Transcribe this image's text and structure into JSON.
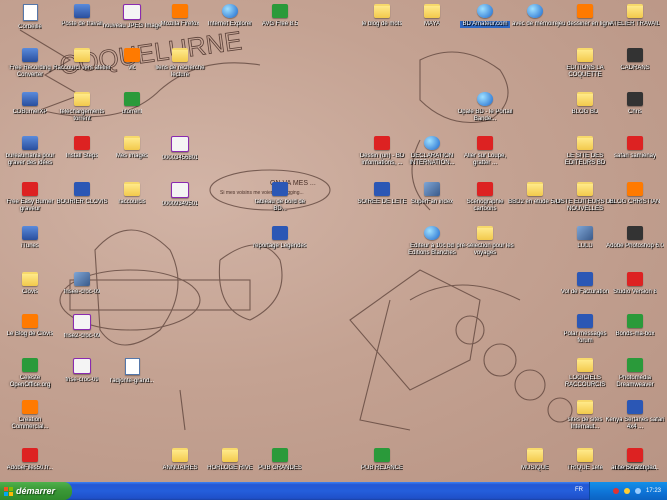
{
  "desktop": {
    "icons": [
      {
        "label": "Corbeille",
        "type": "doc"
      },
      {
        "label": "Poste de travail",
        "type": "app"
      },
      {
        "label": "nouveau JPEG Image",
        "type": "jpeg"
      },
      {
        "label": "Mozilla Firefox",
        "type": "orange"
      },
      {
        "label": "Internet Explorer",
        "type": "web"
      },
      {
        "label": "AVG Free 8.5",
        "type": "green"
      },
      {
        "label": "le blog de mots",
        "type": "folder"
      },
      {
        "label": "MAYA",
        "type": "folder"
      },
      {
        "label": "BD Amateur.com",
        "type": "web",
        "selected": true
      },
      {
        "label": "avec de mémoire",
        "type": "web"
      },
      {
        "label": "jeu dessiner en ligne",
        "type": "orange"
      },
      {
        "label": "ATELIER TRAVAIL",
        "type": "folder"
      },
      {
        "label": "Free Recording Converter",
        "type": "app"
      },
      {
        "label": "Raccourci vers atelier",
        "type": "folder"
      },
      {
        "label": "vlc",
        "type": "orange"
      },
      {
        "label": "liens de recherche lecture",
        "type": "folder"
      },
      {
        "label": "EDITIONS LA COQUETTE",
        "type": "folder"
      },
      {
        "label": "CADRANS",
        "type": "dark"
      },
      {
        "label": "CDBurnerXP",
        "type": "app"
      },
      {
        "label": "téléchargements torrent",
        "type": "folder"
      },
      {
        "label": "utorrent",
        "type": "green"
      },
      {
        "label": "Opale BD - le Portail Bande...",
        "type": "web"
      },
      {
        "label": "BLOG BD",
        "type": "folder"
      },
      {
        "label": "Chris",
        "type": "dark"
      },
      {
        "label": "bureaumania pour graver des idées",
        "type": "app"
      },
      {
        "label": "Install Steps",
        "type": "red"
      },
      {
        "label": "Mes images",
        "type": "folder"
      },
      {
        "label": "00003456801",
        "type": "jpeg"
      },
      {
        "label": "Dessin (un) - BD informations, ...",
        "type": "red"
      },
      {
        "label": "DECLARATION INTERNATION...",
        "type": "web"
      },
      {
        "label": "Aller sur Loupe, gratter ...",
        "type": "red"
      },
      {
        "label": "LE SITE DES EDITEURS BD",
        "type": "folder"
      },
      {
        "label": "safari samienay",
        "type": "red"
      },
      {
        "label": "Free Easy Burner graveur",
        "type": "red"
      },
      {
        "label": "BOURIER CLOVIS",
        "type": "word"
      },
      {
        "label": "raccourcis",
        "type": "folder"
      },
      {
        "label": "00009349501",
        "type": "jpeg"
      },
      {
        "label": "tableau de bord de BD...",
        "type": "word"
      },
      {
        "label": "SOIREE DE LETE",
        "type": "word"
      },
      {
        "label": "SuperFan index",
        "type": "photo"
      },
      {
        "label": "Scénographie cartoons",
        "type": "red"
      },
      {
        "label": "BBD2 en etude 5AX",
        "type": "folder"
      },
      {
        "label": "LISTE EDITEURS DE NOUVELLES",
        "type": "folder"
      },
      {
        "label": "BLOG CHRISTIAN",
        "type": "orange"
      },
      {
        "label": "iTunes",
        "type": "app"
      },
      {
        "label": "reportage Legendes",
        "type": "word"
      },
      {
        "label": "Editeur à 10c bd Editions Blanches",
        "type": "web"
      },
      {
        "label": "pré-sélection pour les voyages",
        "type": "folder"
      },
      {
        "label": "LULU",
        "type": "photo"
      },
      {
        "label": "Adobe Photoshop 6.0",
        "type": "dark"
      },
      {
        "label": "Clovis",
        "type": "folder"
      },
      {
        "label": "frisee-croc-09",
        "type": "photo"
      },
      {
        "label": "Vol de Facturation",
        "type": "word"
      },
      {
        "label": "Studio Version 8",
        "type": "red"
      },
      {
        "label": "Le Blog de Clovis",
        "type": "orange"
      },
      {
        "label": "frise2-croc-09",
        "type": "jpeg"
      },
      {
        "label": "Polar messages forum",
        "type": "word"
      },
      {
        "label": "Bonds-ma-box",
        "type": "green"
      },
      {
        "label": "Celeste OpenOffice.org",
        "type": "green"
      },
      {
        "label": "frise-croc-09",
        "type": "jpeg"
      },
      {
        "label": "l'adjonte-grand...",
        "type": "doc"
      },
      {
        "label": "LOGICIELS RACCOURCIS",
        "type": "folder"
      },
      {
        "label": "Photomédia Dreamweaver",
        "type": "green"
      },
      {
        "label": "Creation Commercial...",
        "type": "orange"
      },
      {
        "label": "sites de sites Internaut...",
        "type": "folder"
      },
      {
        "label": "Kenya Sertanes safari 4x4 ...",
        "type": "word"
      },
      {
        "label": "AdobeFiles50.fr...",
        "type": "red"
      },
      {
        "label": "ANNUAIRES",
        "type": "folder"
      },
      {
        "label": "HORLOGE RIVE",
        "type": "folder"
      },
      {
        "label": "PUB GRANDES",
        "type": "green"
      },
      {
        "label": "PUB REJANCE",
        "type": "green"
      },
      {
        "label": "MUSIQUE",
        "type": "folder"
      },
      {
        "label": "TRIQUE 1ete",
        "type": "folder"
      },
      {
        "label": "accorde à de le ...",
        "type": "folder"
      },
      {
        "label": "The Scratchpad",
        "type": "red"
      }
    ]
  },
  "wallpaper": {
    "sketch_text_1": "COQUELURNE",
    "sketch_text_2": "ON VA MES ...",
    "speech_bubble": "Si mes voisins me voient en jogging..."
  },
  "taskbar": {
    "start_label": "démarrer",
    "language": "FR",
    "clock": "17:23"
  },
  "colors": {
    "taskbar": "#245edb",
    "start": "#3c9a38",
    "selection": "#316ac5"
  }
}
